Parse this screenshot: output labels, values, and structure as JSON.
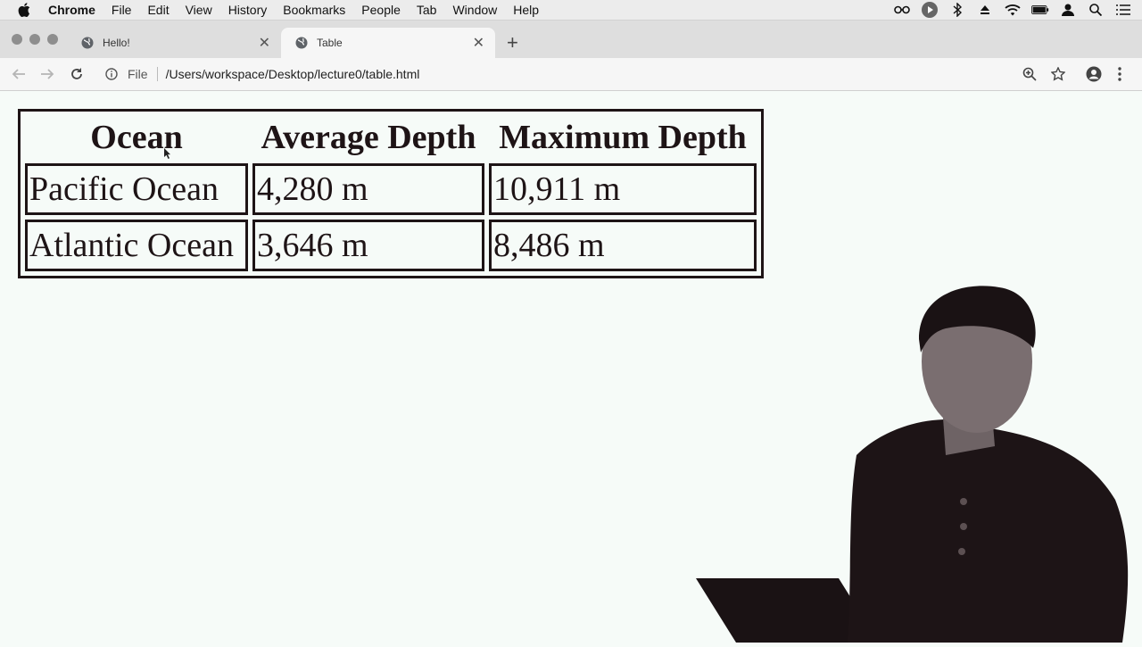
{
  "menubar": {
    "app": "Chrome",
    "items": [
      "File",
      "Edit",
      "View",
      "History",
      "Bookmarks",
      "People",
      "Tab",
      "Window",
      "Help"
    ]
  },
  "tabs": [
    {
      "title": "Hello!",
      "active": false
    },
    {
      "title": "Table",
      "active": true
    }
  ],
  "toolbar": {
    "scheme": "File",
    "url": "/Users/workspace/Desktop/lecture0/table.html"
  },
  "table": {
    "headers": [
      "Ocean",
      "Average Depth",
      "Maximum Depth"
    ],
    "rows": [
      [
        "Pacific Ocean",
        "4,280 m",
        "10,911 m"
      ],
      [
        "Atlantic Ocean",
        "3,646 m",
        "8,486 m"
      ]
    ]
  },
  "colors": {
    "page_background": "#f6fbf8",
    "table_ink": "#1e1416",
    "chrome_tab_strip": "#dedede"
  },
  "icons": {
    "menubar_status": [
      "glasses-icon",
      "play-icon",
      "bluetooth-icon",
      "eject-icon",
      "wifi-icon",
      "battery-icon",
      "user-icon",
      "search-icon",
      "list-icon"
    ]
  }
}
